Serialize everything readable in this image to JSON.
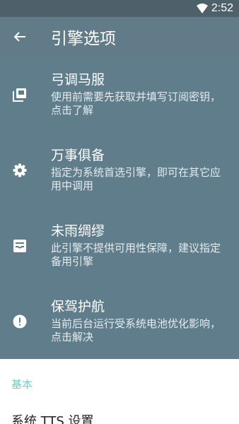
{
  "status_bar": {
    "time": "2:52"
  },
  "app_bar": {
    "title": "引擎选项"
  },
  "items": [
    {
      "icon": "collections-icon",
      "title": "弓调马服",
      "subtitle": "使用前需要先获取并填写订阅密钥，点击了解"
    },
    {
      "icon": "gear-icon",
      "title": "万事俱备",
      "subtitle": "指定为系统首选引擎，即可在其它应用中调用"
    },
    {
      "icon": "inbox-icon",
      "title": "未雨绸缪",
      "subtitle": "此引擎不提供可用性保障，建议指定备用引擎"
    },
    {
      "icon": "alert-circle-icon",
      "title": "保驾护航",
      "subtitle": "当前后台运行受系统电池优化影响，点击解决"
    }
  ],
  "section": {
    "header": "基本"
  },
  "prefs": [
    {
      "title": "系统 TTS 设置"
    }
  ],
  "colors": {
    "status_bar": "#4e6069",
    "app_bar": "#617c88",
    "panel": "#607d8b",
    "accent": "#80cbc4"
  }
}
